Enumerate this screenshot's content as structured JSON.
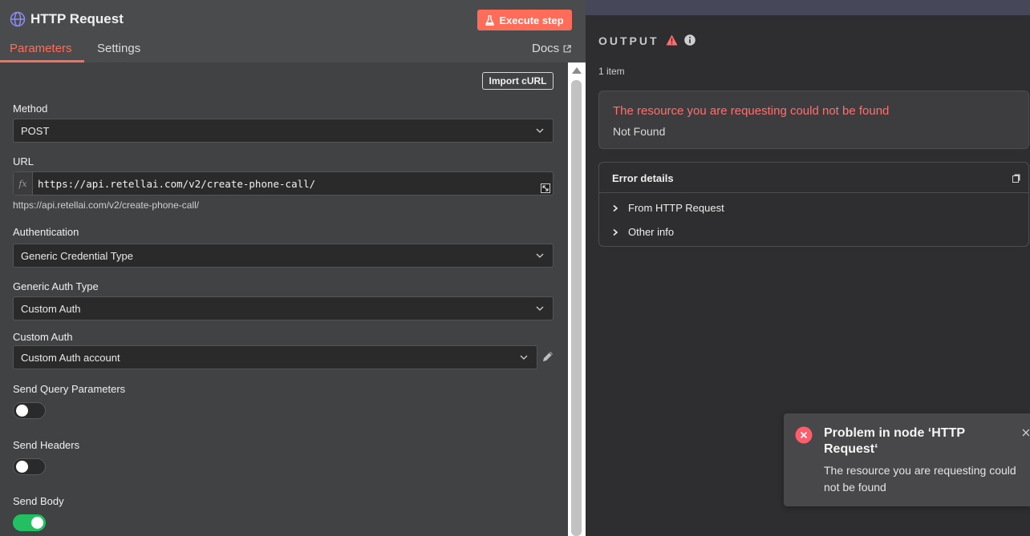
{
  "node": {
    "title": "HTTP Request",
    "execute_label": "Execute step",
    "tabs": [
      {
        "label": "Parameters",
        "active": true
      },
      {
        "label": "Settings",
        "active": false
      }
    ],
    "docs_label": "Docs",
    "import_curl_label": "Import cURL"
  },
  "params": {
    "method": {
      "label": "Method",
      "value": "POST"
    },
    "url": {
      "label": "URL",
      "value": "https://api.retellai.com/v2/create-phone-call/",
      "hint": "https://api.retellai.com/v2/create-phone-call/",
      "expr_icon": "fx"
    },
    "authentication": {
      "label": "Authentication",
      "value": "Generic Credential Type"
    },
    "generic_auth_type": {
      "label": "Generic Auth Type",
      "value": "Custom Auth"
    },
    "custom_auth": {
      "label": "Custom Auth",
      "value": "Custom Auth account"
    },
    "send_query": {
      "label": "Send Query Parameters",
      "on": false
    },
    "send_headers": {
      "label": "Send Headers",
      "on": false
    },
    "send_body": {
      "label": "Send Body",
      "on": true
    }
  },
  "output": {
    "title": "OUTPUT",
    "items_count": "1 item",
    "error_title": "The resource you are requesting could not be found",
    "error_subtitle": "Not Found",
    "details_title": "Error details",
    "details_rows": [
      "From HTTP Request",
      "Other info"
    ]
  },
  "toast": {
    "title": "Problem in node ‘HTTP Request‘",
    "message": "The resource you are requesting could not be found"
  },
  "colors": {
    "accent": "#ff6d5a",
    "error_text": "#ff6f6f",
    "toggle_on": "#22c063"
  }
}
